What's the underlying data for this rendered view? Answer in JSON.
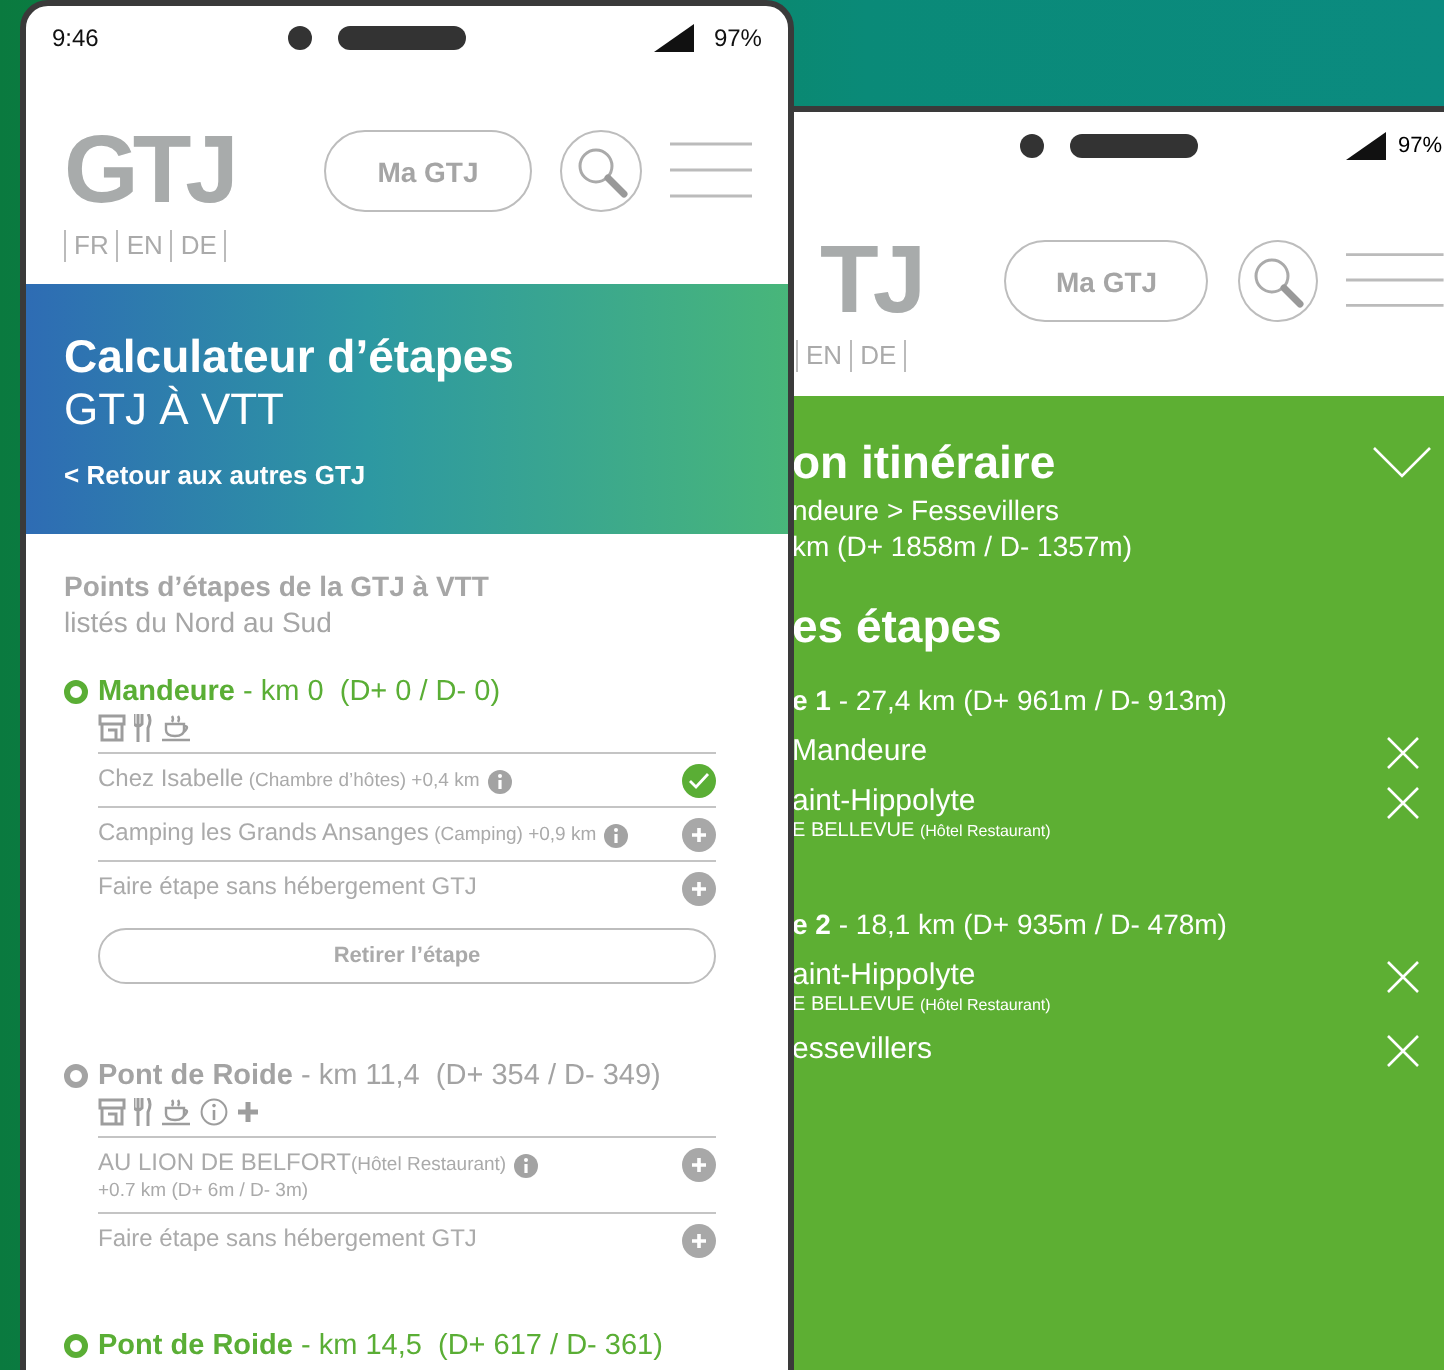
{
  "left_phone": {
    "status_bar": {
      "time": "9:46",
      "battery": "97%"
    },
    "header": {
      "logo": "GTJ",
      "languages": [
        "FR",
        "EN",
        "DE"
      ],
      "account_button": "Ma GTJ"
    },
    "banner": {
      "title": "Calculateur d’étapes",
      "subtitle": "GTJ À VTT",
      "back_link": "< Retour aux autres GTJ"
    },
    "section": {
      "title": "Points d’étapes de la GTJ à VTT",
      "subtitle": "listés du Nord au Sud"
    },
    "stages": [
      {
        "heading": "**Mandeure** - km 0  (D+ 0 / D- 0)",
        "selected": true,
        "amenities": [
          {
            "kind": "shop"
          },
          {
            "kind": "restaurant"
          },
          {
            "kind": "cafe"
          }
        ],
        "options": [
          {
            "name": "Chez Isabelle",
            "type": "(Chambre d’hôtes)",
            "distance": "+0,4 km",
            "info": true,
            "chosen": true
          },
          {
            "name": "Camping les Grands Ansanges",
            "type": "(Camping)",
            "distance": "+0,9 km",
            "info": true,
            "chosen": false
          },
          {
            "name": "Faire étape sans hébergement GTJ",
            "info": false,
            "chosen": false
          }
        ],
        "remove_button": "Retirer l’étape"
      },
      {
        "heading": "**Pont de Roide** - km 11,4  (D+ 354 / D- 349)",
        "selected": false,
        "amenities": [
          {
            "kind": "shop"
          },
          {
            "kind": "restaurant"
          },
          {
            "kind": "cafe"
          },
          {
            "kind": "info"
          },
          {
            "kind": "plus"
          }
        ],
        "options": [
          {
            "name": "AU LION DE BELFORT",
            "type": "(Hôtel Restaurant)",
            "detail": "+0.7 km (D+ 6m / D- 3m)",
            "info": true,
            "chosen": false
          },
          {
            "name": "Faire étape sans hébergement GTJ",
            "info": false,
            "chosen": false
          }
        ]
      },
      {
        "heading": "**Pont de Roide** - km 14,5  (D+ 617 / D- 361)",
        "selected": true
      }
    ]
  },
  "right_phone": {
    "status_bar": {
      "battery": "97%"
    },
    "header": {
      "logo": "TJ",
      "languages": [
        "EN",
        "DE"
      ],
      "account_button": "Ma GTJ"
    },
    "itinerary": {
      "title": "on itinéraire",
      "route": "ndeure > Fessevillers",
      "summary": "km (D+ 1858m / D- 1357m)"
    },
    "stages_title": "es étapes",
    "legs": [
      {
        "heading": "**e 1** - 27,4 km (D+ 961m / D- 913m)",
        "stops": [
          {
            "name": "Mandeure"
          },
          {
            "name": "aint-Hippolyte",
            "lodging": "E BELLEVUE",
            "lodging_type": "(Hôtel Restaurant)"
          }
        ]
      },
      {
        "heading": "**e 2** - 18,1 km (D+ 935m / D- 478m)",
        "stops": [
          {
            "name": "aint-Hippolyte",
            "lodging": "E BELLEVUE",
            "lodging_type": "(Hôtel Restaurant)"
          },
          {
            "name": "essevillers"
          }
        ]
      }
    ]
  }
}
